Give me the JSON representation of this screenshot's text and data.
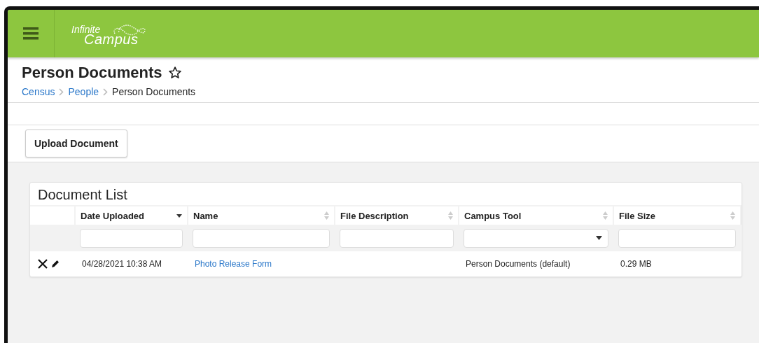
{
  "header": {
    "logo": {
      "line_1": "Infinite",
      "line_2": "Campus"
    }
  },
  "page": {
    "title": "Person Documents",
    "favorite": false,
    "breadcrumb": [
      {
        "label": "Census",
        "link": true
      },
      {
        "label": "People",
        "link": true
      },
      {
        "label": "Person Documents",
        "link": false
      }
    ]
  },
  "toolbar": {
    "buttons": [
      "Upload Document"
    ]
  },
  "document_list": {
    "title": "Document List",
    "columns": [
      {
        "label": "Date Uploaded",
        "sorted_descending": true,
        "kind": "text"
      },
      {
        "label": "Name",
        "sorted_descending": false,
        "kind": "text"
      },
      {
        "label": "File Description",
        "sorted_descending": false,
        "kind": "text"
      },
      {
        "label": "Campus Tool",
        "sorted_descending": false,
        "kind": "select"
      },
      {
        "label": "File Size",
        "sorted_descending": false,
        "kind": "text"
      }
    ],
    "rows": [
      {
        "date_uploaded": "04/28/2021 10:38 AM",
        "name": "Photo Release Form",
        "campus_tool": "Person Documents (default)",
        "file_size": "0.29 MB"
      }
    ]
  }
}
